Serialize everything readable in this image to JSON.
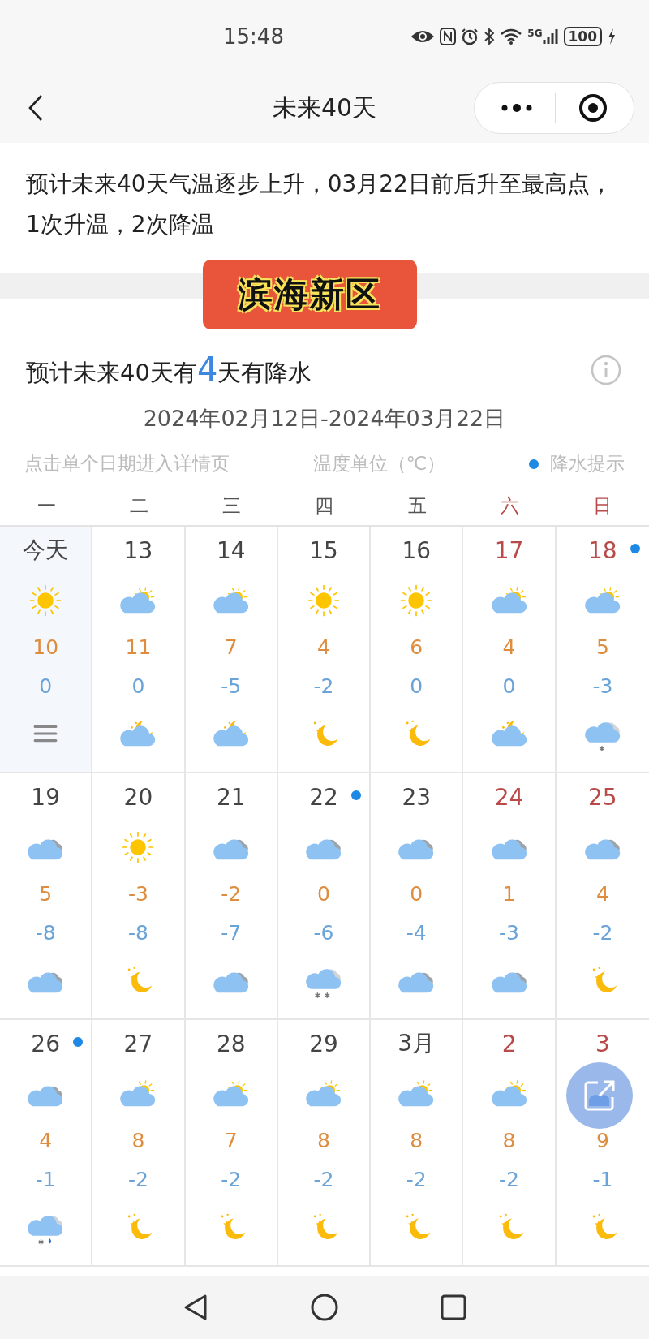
{
  "status_bar": {
    "time": "15:48",
    "network": "5G",
    "battery": "100"
  },
  "nav": {
    "title": "未来40天"
  },
  "summary": "预计未来40天气温逐步上升，03月22日前后升至最高点，1次升温，2次降温",
  "badge": "滨海新区",
  "precipitation": {
    "before": "预计未来40天有",
    "count": "4",
    "after": "天有降水"
  },
  "date_range": "2024年02月12日-2024年03月22日",
  "hints": {
    "tap": "点击单个日期进入详情页",
    "unit": "温度单位（℃）",
    "rain": "降水提示"
  },
  "weekdays": [
    "一",
    "二",
    "三",
    "四",
    "五",
    "六",
    "日"
  ],
  "days": [
    {
      "date": "今天",
      "today": true,
      "rain": false,
      "day_icon": {
        "kind": "sun"
      },
      "high": "10",
      "low": "0",
      "night_icon": {
        "kind": "list"
      }
    },
    {
      "date": "13",
      "today": false,
      "rain": false,
      "day_icon": {
        "kind": "partly"
      },
      "high": "11",
      "low": "0",
      "night_icon": {
        "kind": "cloud-moon"
      }
    },
    {
      "date": "14",
      "today": false,
      "rain": false,
      "day_icon": {
        "kind": "partly"
      },
      "high": "7",
      "low": "-5",
      "night_icon": {
        "kind": "cloud-moon"
      }
    },
    {
      "date": "15",
      "today": false,
      "rain": false,
      "day_icon": {
        "kind": "sun"
      },
      "high": "4",
      "low": "-2",
      "night_icon": {
        "kind": "moon"
      }
    },
    {
      "date": "16",
      "today": false,
      "rain": false,
      "day_icon": {
        "kind": "sun"
      },
      "high": "6",
      "low": "0",
      "night_icon": {
        "kind": "moon"
      }
    },
    {
      "date": "17",
      "today": false,
      "rain": false,
      "day_icon": {
        "kind": "partly"
      },
      "high": "4",
      "low": "0",
      "night_icon": {
        "kind": "cloud-moon"
      }
    },
    {
      "date": "18",
      "today": false,
      "rain": true,
      "day_icon": {
        "kind": "partly"
      },
      "high": "5",
      "low": "-3",
      "night_icon": {
        "kind": "snow"
      }
    },
    {
      "date": "19",
      "today": false,
      "rain": false,
      "day_icon": {
        "kind": "cloudy"
      },
      "high": "5",
      "low": "-8",
      "night_icon": {
        "kind": "cloudy"
      }
    },
    {
      "date": "20",
      "today": false,
      "rain": false,
      "day_icon": {
        "kind": "sun"
      },
      "high": "-3",
      "low": "-8",
      "night_icon": {
        "kind": "moon"
      }
    },
    {
      "date": "21",
      "today": false,
      "rain": false,
      "day_icon": {
        "kind": "cloudy"
      },
      "high": "-2",
      "low": "-7",
      "night_icon": {
        "kind": "cloudy"
      }
    },
    {
      "date": "22",
      "today": false,
      "rain": true,
      "day_icon": {
        "kind": "cloudy"
      },
      "high": "0",
      "low": "-6",
      "night_icon": {
        "kind": "heavy-snow"
      }
    },
    {
      "date": "23",
      "today": false,
      "rain": false,
      "day_icon": {
        "kind": "cloudy"
      },
      "high": "0",
      "low": "-4",
      "night_icon": {
        "kind": "cloudy"
      }
    },
    {
      "date": "24",
      "today": false,
      "rain": false,
      "day_icon": {
        "kind": "cloudy"
      },
      "high": "1",
      "low": "-3",
      "night_icon": {
        "kind": "cloudy"
      }
    },
    {
      "date": "25",
      "today": false,
      "rain": false,
      "day_icon": {
        "kind": "cloudy"
      },
      "high": "4",
      "low": "-2",
      "night_icon": {
        "kind": "moon"
      }
    },
    {
      "date": "26",
      "today": false,
      "rain": true,
      "day_icon": {
        "kind": "cloudy"
      },
      "high": "4",
      "low": "-1",
      "night_icon": {
        "kind": "sleet"
      }
    },
    {
      "date": "27",
      "today": false,
      "rain": false,
      "day_icon": {
        "kind": "partly"
      },
      "high": "8",
      "low": "-2",
      "night_icon": {
        "kind": "moon"
      }
    },
    {
      "date": "28",
      "today": false,
      "rain": false,
      "day_icon": {
        "kind": "partly"
      },
      "high": "7",
      "low": "-2",
      "night_icon": {
        "kind": "moon"
      }
    },
    {
      "date": "29",
      "today": false,
      "rain": false,
      "day_icon": {
        "kind": "partly"
      },
      "high": "8",
      "low": "-2",
      "night_icon": {
        "kind": "moon"
      }
    },
    {
      "date": "3月",
      "today": false,
      "rain": false,
      "day_icon": {
        "kind": "partly"
      },
      "high": "8",
      "low": "-2",
      "night_icon": {
        "kind": "moon"
      }
    },
    {
      "date": "2",
      "today": false,
      "rain": false,
      "day_icon": {
        "kind": "partly"
      },
      "high": "8",
      "low": "-2",
      "night_icon": {
        "kind": "moon"
      }
    },
    {
      "date": "3",
      "today": false,
      "rain": false,
      "high": "9",
      "low": "-1",
      "night_icon": {
        "kind": "moon"
      }
    }
  ]
}
